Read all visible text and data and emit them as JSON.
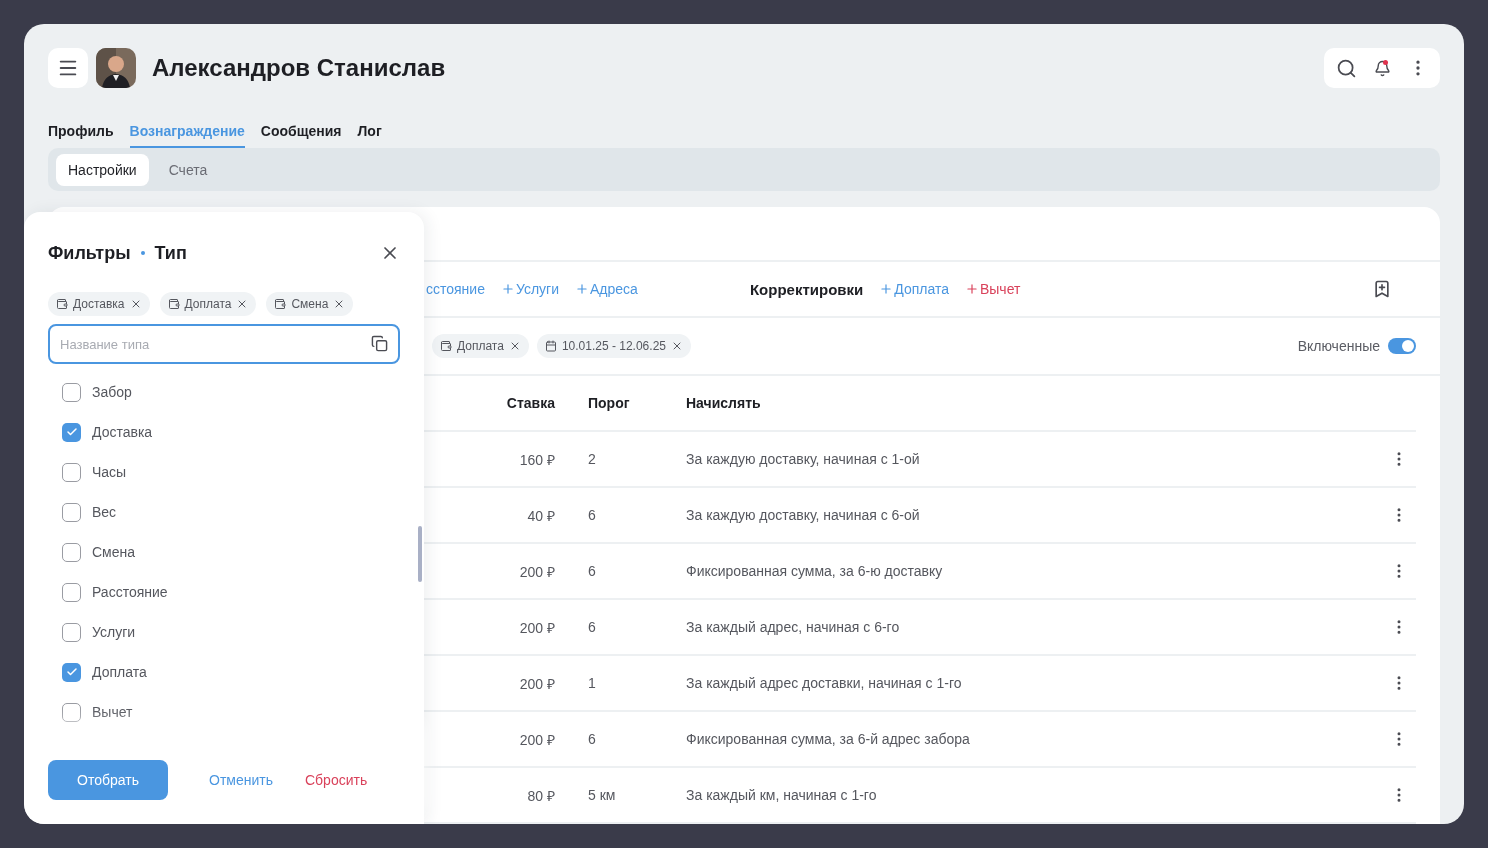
{
  "header": {
    "title": "Александров Станислав",
    "notification_dot": true
  },
  "tabs": [
    {
      "label": "Профиль",
      "selected": false
    },
    {
      "label": "Вознаграждение",
      "selected": true
    },
    {
      "label": "Сообщения",
      "selected": false
    },
    {
      "label": "Лог",
      "selected": false
    }
  ],
  "subtabs": [
    {
      "label": "Настройки",
      "selected": true
    },
    {
      "label": "Счета",
      "selected": false
    }
  ],
  "type_links": [
    {
      "label": "сстояние",
      "plus": false
    },
    {
      "label": "Услуги",
      "plus": true
    },
    {
      "label": "Адреса",
      "plus": true
    }
  ],
  "corrections": {
    "title": "Корректировки",
    "links": [
      {
        "label": "Доплата",
        "kind": "addition"
      },
      {
        "label": "Вычет",
        "kind": "deduction"
      }
    ]
  },
  "active_filters": [
    {
      "label": "Доплата",
      "kind": "type"
    },
    {
      "label": "10.01.25 - 12.06.25",
      "kind": "date"
    }
  ],
  "enabled_toggle": {
    "label": "Включенные",
    "on": true
  },
  "table": {
    "columns": [
      "Ставка",
      "Порог",
      "Начислять"
    ],
    "rows": [
      {
        "rate": "160 ₽",
        "threshold": "2",
        "accrue": "За каждую доставку, начиная с 1-ой"
      },
      {
        "rate": "40 ₽",
        "threshold": "6",
        "accrue": "За каждую доставку, начиная с 6-ой"
      },
      {
        "rate": "200 ₽",
        "threshold": "6",
        "accrue": "Фиксированная сумма, за 6-ю доставку"
      },
      {
        "rate": "200 ₽",
        "threshold": "6",
        "accrue": "За каждый адрес, начиная с 6-го"
      },
      {
        "rate": "200 ₽",
        "threshold": "1",
        "accrue": "За каждый адрес доставки, начиная с 1-го"
      },
      {
        "rate": "200 ₽",
        "threshold": "6",
        "accrue": "Фиксированная сумма, за 6-й адрес забора"
      },
      {
        "rate": "80 ₽",
        "threshold": "5 км",
        "accrue": "За каждый км, начиная с 1-го"
      }
    ]
  },
  "filter_panel": {
    "title": "Фильтры",
    "subtitle": "Тип",
    "chips": [
      {
        "label": "Доставка"
      },
      {
        "label": "Доплата"
      },
      {
        "label": "Смена"
      }
    ],
    "search": {
      "placeholder": "Название типа"
    },
    "options": [
      {
        "label": "Забор",
        "checked": false
      },
      {
        "label": "Доставка",
        "checked": true
      },
      {
        "label": "Часы",
        "checked": false
      },
      {
        "label": "Вес",
        "checked": false
      },
      {
        "label": "Смена",
        "checked": false
      },
      {
        "label": "Расстояние",
        "checked": false
      },
      {
        "label": "Услуги",
        "checked": false
      },
      {
        "label": "Доплата",
        "checked": true
      },
      {
        "label": "Вычет",
        "checked": false
      }
    ],
    "buttons": [
      {
        "label": "Отобрать",
        "kind": "primary"
      },
      {
        "label": "Отменить",
        "kind": "secondary"
      },
      {
        "label": "Сбросить",
        "kind": "danger"
      }
    ]
  }
}
